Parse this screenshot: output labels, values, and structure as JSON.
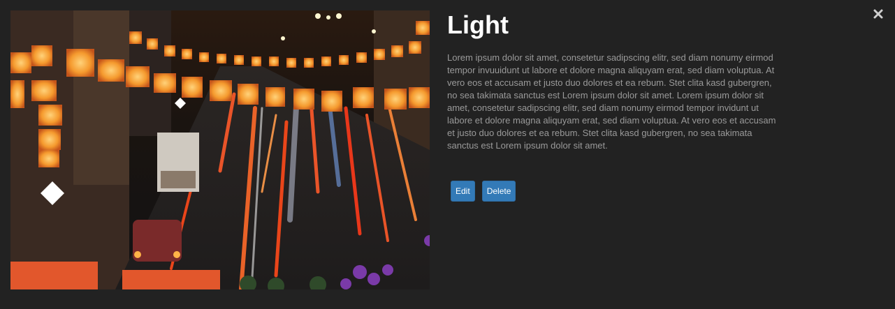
{
  "modal": {
    "title": "Light",
    "description": "Lorem ipsum dolor sit amet, consetetur sadipscing elitr, sed diam nonumy eirmod tempor invuuidunt ut labore et dolore magna aliquyam erat, sed diam voluptua. At vero eos et accusam et justo duo dolores et ea rebum. Stet clita kasd gubergren, no sea takimata sanctus est Lorem ipsum dolor sit amet. Lorem ipsum dolor sit amet, consetetur sadipscing elitr, sed diam nonumy eirmod tempor invidunt ut labore et dolore magna aliquyam erat, sed diam voluptua. At vero eos et accusam et justo duo dolores et ea rebum. Stet clita kasd gubergren, no sea takimata sanctus est Lorem ipsum dolor sit amet.",
    "close_icon": "close-icon",
    "image_icon": "photo"
  },
  "actions": {
    "edit_label": "Edit",
    "delete_label": "Delete"
  },
  "colors": {
    "background": "#222222",
    "title": "#ffffff",
    "description": "#9a9a9a",
    "button": "#337ab7"
  }
}
